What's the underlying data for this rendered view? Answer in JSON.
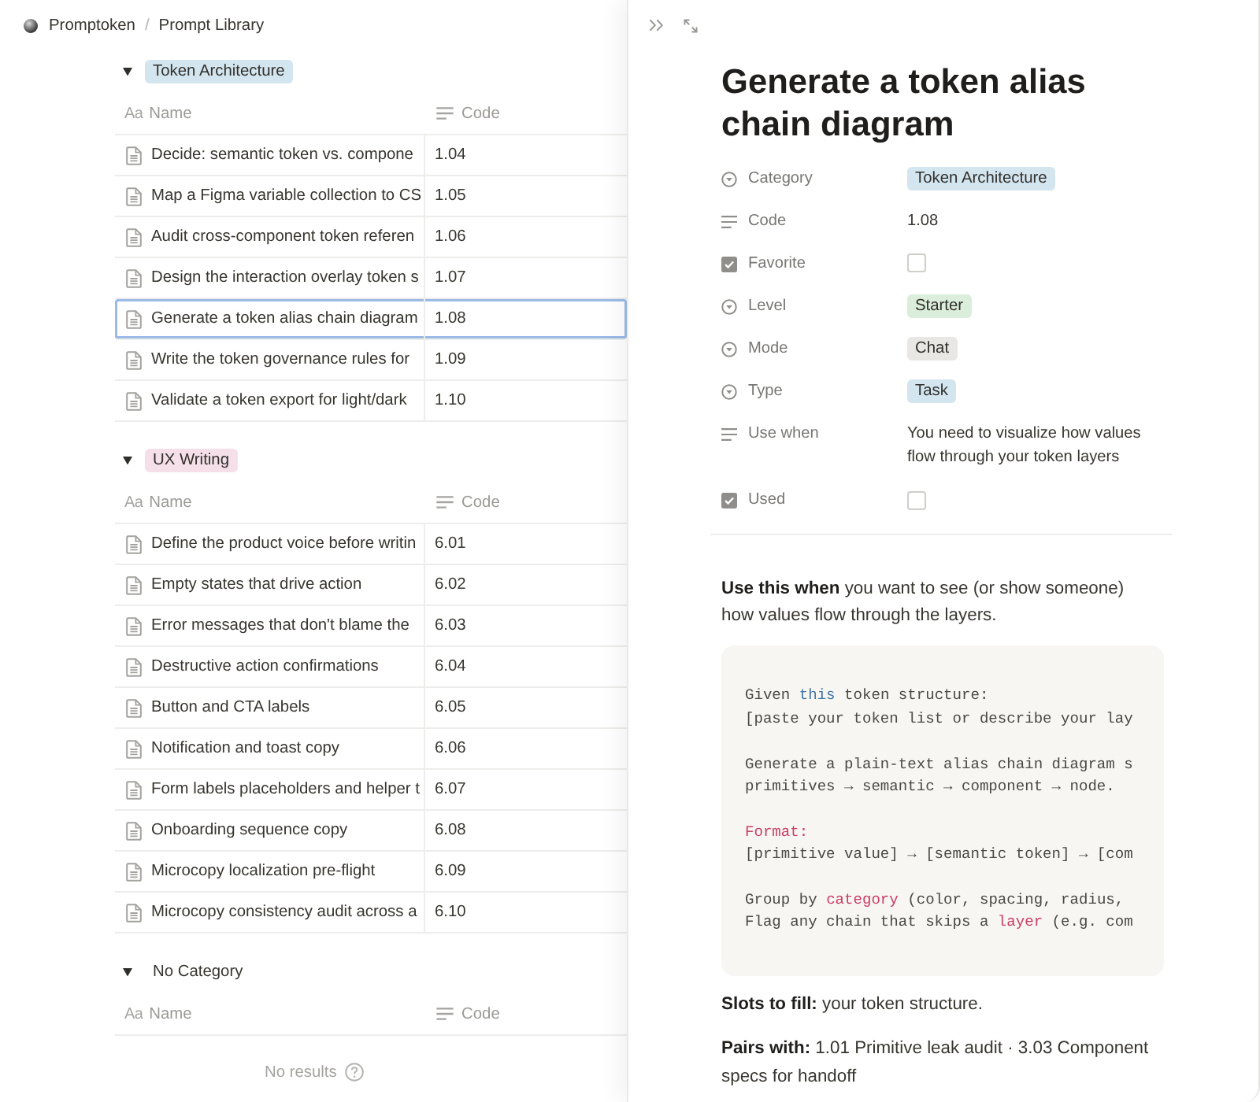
{
  "breadcrumb": {
    "workspace": "Promptoken",
    "separator": "/",
    "page": "Prompt Library"
  },
  "groups": [
    {
      "label": "Token Architecture",
      "color": "#d3e5ef",
      "expanded": true,
      "columns": [
        {
          "kind": "title",
          "glyph": "Aa",
          "label": "Name"
        },
        {
          "kind": "text",
          "label": "Code"
        }
      ],
      "rows": [
        {
          "name": "Decide: semantic token vs. compone",
          "code": "1.04",
          "selected": false
        },
        {
          "name": "Map a Figma variable collection to CS",
          "code": "1.05",
          "selected": false
        },
        {
          "name": "Audit cross-component token referen",
          "code": "1.06",
          "selected": false
        },
        {
          "name": "Design the interaction overlay token s",
          "code": "1.07",
          "selected": false
        },
        {
          "name": "Generate a token alias chain diagram",
          "code": "1.08",
          "selected": true
        },
        {
          "name": "Write the token governance rules for",
          "code": "1.09",
          "selected": false
        },
        {
          "name": "Validate a token export for light/dark",
          "code": "1.10",
          "selected": false
        }
      ]
    },
    {
      "label": "UX Writing",
      "color": "#f5e0ea",
      "expanded": true,
      "columns": [
        {
          "kind": "title",
          "glyph": "Aa",
          "label": "Name"
        },
        {
          "kind": "text",
          "label": "Code"
        }
      ],
      "rows": [
        {
          "name": "Define the product voice before writin",
          "code": "6.01",
          "selected": false
        },
        {
          "name": "Empty states that drive action",
          "code": "6.02",
          "selected": false
        },
        {
          "name": "Error messages that don't blame the",
          "code": "6.03",
          "selected": false
        },
        {
          "name": "Destructive action confirmations",
          "code": "6.04",
          "selected": false
        },
        {
          "name": "Button and CTA labels",
          "code": "6.05",
          "selected": false
        },
        {
          "name": "Notification and toast copy",
          "code": "6.06",
          "selected": false
        },
        {
          "name": "Form labels placeholders and helper t",
          "code": "6.07",
          "selected": false
        },
        {
          "name": "Onboarding sequence copy",
          "code": "6.08",
          "selected": false
        },
        {
          "name": "Microcopy localization pre-flight",
          "code": "6.09",
          "selected": false
        },
        {
          "name": "Microcopy consistency audit across a",
          "code": "6.10",
          "selected": false
        }
      ]
    },
    {
      "label": "No Category",
      "expanded": true,
      "columns": [
        {
          "kind": "title",
          "glyph": "Aa",
          "label": "Name"
        },
        {
          "kind": "text",
          "label": "Code"
        }
      ],
      "empty_message": "No results"
    }
  ],
  "page": {
    "title": "Generate a token alias chain diagram",
    "properties": [
      {
        "kind": "select",
        "label": "Category",
        "value": "Token Architecture",
        "color": "#d3e5ef"
      },
      {
        "kind": "text",
        "label": "Code",
        "value": "1.08"
      },
      {
        "kind": "checkbox",
        "label": "Favorite",
        "checked": false
      },
      {
        "kind": "select",
        "label": "Level",
        "value": "Starter",
        "color": "#dbeddb"
      },
      {
        "kind": "select",
        "label": "Mode",
        "value": "Chat",
        "color": "#e8e7e4"
      },
      {
        "kind": "select",
        "label": "Type",
        "value": "Task",
        "color": "#d3e5ef"
      },
      {
        "kind": "text",
        "label": "Use when",
        "value": "You need to visualize how values flow through your token layers"
      },
      {
        "kind": "checkbox",
        "label": "Used",
        "checked": false
      }
    ],
    "intro": "**Use this when** you want to see (or show someone) how values flow through the layers.",
    "code_block": [
      [
        [
          {
            "text": "Given ",
            "kind": "plain"
          },
          {
            "text": "this",
            "kind": "keyword"
          },
          {
            "text": " token structure:",
            "kind": "plain"
          }
        ],
        [
          {
            "text": "[paste your token list or describe your lay",
            "kind": "plain"
          }
        ]
      ],
      [
        [
          {
            "text": "Generate a plain-text alias chain diagram s",
            "kind": "plain"
          }
        ],
        [
          {
            "text": "primitives → semantic → component → node.",
            "kind": "plain"
          }
        ]
      ],
      [
        [
          {
            "text": "Format:",
            "kind": "accent"
          }
        ],
        [
          {
            "text": "[primitive value] → [semantic token] → [com",
            "kind": "plain"
          }
        ]
      ],
      [
        [
          {
            "text": "Group by ",
            "kind": "plain"
          },
          {
            "text": "category",
            "kind": "accent"
          },
          {
            "text": " (color, spacing, radius,",
            "kind": "plain"
          }
        ],
        [
          {
            "text": "Flag any chain that skips a ",
            "kind": "plain"
          },
          {
            "text": "layer",
            "kind": "accent"
          },
          {
            "text": " (e.g. com",
            "kind": "plain"
          }
        ]
      ]
    ],
    "notes": [
      "**Slots to fill:** your token structure.",
      "**Pairs with:** 1.01 Primitive leak audit · 3.03 Component specs for handoff"
    ]
  }
}
